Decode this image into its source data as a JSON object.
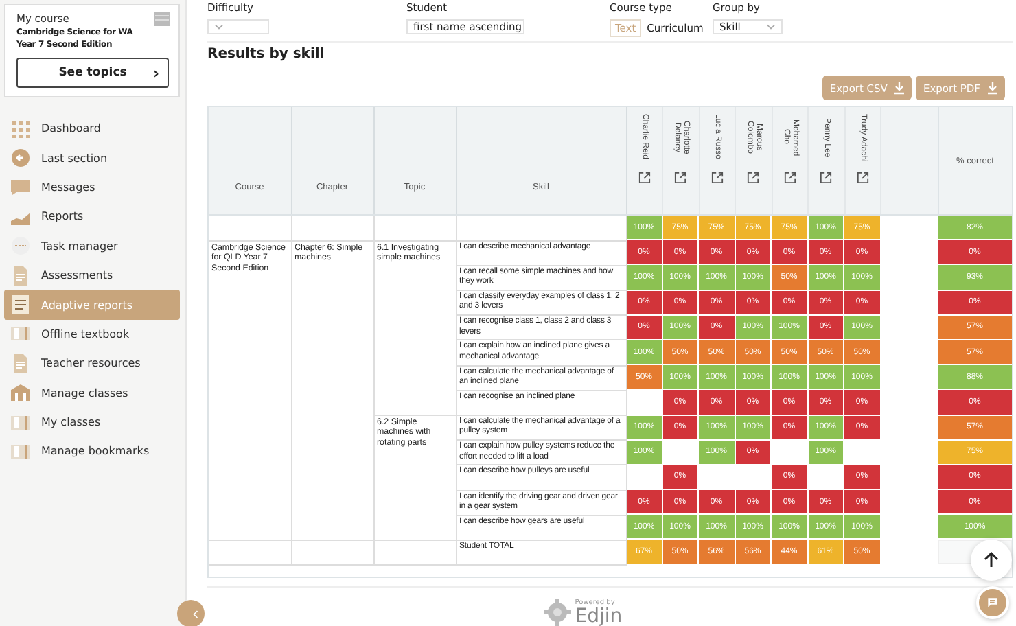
{
  "sidebar": {
    "course_card": {
      "label": "My course",
      "title": "Cambridge Science for WA Year 7 Second Edition",
      "button": "See topics",
      "button_icon": "›"
    },
    "items": [
      {
        "label": "Dashboard",
        "kind": "grid",
        "selected": false
      },
      {
        "label": "Last section",
        "kind": "back",
        "selected": false
      },
      {
        "label": "Messages",
        "kind": "message",
        "selected": false
      },
      {
        "label": "Reports",
        "kind": "chart",
        "selected": false
      },
      {
        "label": "Task manager",
        "kind": "task",
        "selected": false
      },
      {
        "label": "Assessments",
        "kind": "doc",
        "selected": false
      },
      {
        "label": "Adaptive reports",
        "kind": "adaptive",
        "selected": true
      },
      {
        "label": "Offline textbook",
        "kind": "book",
        "selected": false
      },
      {
        "label": "Teacher resources",
        "kind": "doc",
        "selected": false
      },
      {
        "label": "Manage classes",
        "kind": "school",
        "selected": false
      },
      {
        "label": "My classes",
        "kind": "book",
        "selected": false
      },
      {
        "label": "Manage bookmarks",
        "kind": "book",
        "selected": false
      }
    ]
  },
  "filters": {
    "difficulty": {
      "label": "Difficulty"
    },
    "student": {
      "label": "Student",
      "value": "first name ascending"
    },
    "course_type": {
      "label": "Course type",
      "options": [
        {
          "label": "Text",
          "selected": true
        },
        {
          "label": "Curriculum",
          "selected": false
        }
      ]
    },
    "group_by": {
      "label": "Group by",
      "value": "Skill"
    }
  },
  "heading": "Results by skill",
  "buttons": [
    "Export CSV",
    "Export PDF"
  ],
  "table": {
    "columns": [
      "Course",
      "Chapter",
      "Topic",
      "Skill"
    ],
    "percent_column": "% correct",
    "students": [
      "Charlie Reid",
      "Charlotte Delaney",
      "Lucia Russo",
      "Marcus Colombo",
      "Mohamed Cho",
      "Penny Lee",
      "Trudy Adachi"
    ],
    "summary_row": {
      "cells": [
        {
          "value": "100%",
          "color": "#8cc152"
        },
        {
          "value": "75%",
          "color": "#eeb32b"
        },
        {
          "value": "75%",
          "color": "#eeb32b"
        },
        {
          "value": "75%",
          "color": "#eeb32b"
        },
        {
          "value": "75%",
          "color": "#eeb32b"
        },
        {
          "value": "100%",
          "color": "#8cc152"
        },
        {
          "value": "75%",
          "color": "#eeb32b"
        }
      ],
      "percent": {
        "value": "82%",
        "color": "#8cc152"
      }
    },
    "course": {
      "name": "Cambridge Science for QLD Year 7 Second Edition",
      "chapters": [
        {
          "name": "Chapter 6: Simple machines",
          "topics": [
            {
              "name": "6.1 Investigating simple machines",
              "skills": [
                {
                  "skill": "I can describe mechanical advantage",
                  "cells": [
                    {
                      "value": "0%",
                      "color": "#d2343a"
                    },
                    {
                      "value": "0%",
                      "color": "#d2343a"
                    },
                    {
                      "value": "0%",
                      "color": "#d2343a"
                    },
                    {
                      "value": "0%",
                      "color": "#d2343a"
                    },
                    {
                      "value": "0%",
                      "color": "#d2343a"
                    },
                    {
                      "value": "0%",
                      "color": "#d2343a"
                    },
                    {
                      "value": "0%",
                      "color": "#d2343a"
                    }
                  ],
                  "percent": {
                    "value": "0%",
                    "color": "#d2343a"
                  }
                },
                {
                  "skill": "I can recall some simple machines and how they work",
                  "cells": [
                    {
                      "value": "100%",
                      "color": "#8cc152"
                    },
                    {
                      "value": "100%",
                      "color": "#8cc152"
                    },
                    {
                      "value": "100%",
                      "color": "#8cc152"
                    },
                    {
                      "value": "100%",
                      "color": "#8cc152"
                    },
                    {
                      "value": "50%",
                      "color": "#e57b30"
                    },
                    {
                      "value": "100%",
                      "color": "#8cc152"
                    },
                    {
                      "value": "100%",
                      "color": "#8cc152"
                    }
                  ],
                  "percent": {
                    "value": "93%",
                    "color": "#8cc152"
                  }
                },
                {
                  "skill": "I can classify everyday examples of class 1, 2 and 3 levers",
                  "cells": [
                    {
                      "value": "0%",
                      "color": "#d2343a"
                    },
                    {
                      "value": "0%",
                      "color": "#d2343a"
                    },
                    {
                      "value": "0%",
                      "color": "#d2343a"
                    },
                    {
                      "value": "0%",
                      "color": "#d2343a"
                    },
                    {
                      "value": "0%",
                      "color": "#d2343a"
                    },
                    {
                      "value": "0%",
                      "color": "#d2343a"
                    },
                    {
                      "value": "0%",
                      "color": "#d2343a"
                    }
                  ],
                  "percent": {
                    "value": "0%",
                    "color": "#d2343a"
                  }
                },
                {
                  "skill": "I can recognise class 1, class 2 and class 3 levers",
                  "cells": [
                    {
                      "value": "0%",
                      "color": "#d2343a"
                    },
                    {
                      "value": "100%",
                      "color": "#8cc152"
                    },
                    {
                      "value": "0%",
                      "color": "#d2343a"
                    },
                    {
                      "value": "100%",
                      "color": "#8cc152"
                    },
                    {
                      "value": "100%",
                      "color": "#8cc152"
                    },
                    {
                      "value": "0%",
                      "color": "#d2343a"
                    },
                    {
                      "value": "100%",
                      "color": "#8cc152"
                    }
                  ],
                  "percent": {
                    "value": "57%",
                    "color": "#e57b30"
                  }
                },
                {
                  "skill": "I can explain how an inclined plane gives a mechanical advantage",
                  "cells": [
                    {
                      "value": "100%",
                      "color": "#8cc152"
                    },
                    {
                      "value": "50%",
                      "color": "#e57b30"
                    },
                    {
                      "value": "50%",
                      "color": "#e57b30"
                    },
                    {
                      "value": "50%",
                      "color": "#e57b30"
                    },
                    {
                      "value": "50%",
                      "color": "#e57b30"
                    },
                    {
                      "value": "50%",
                      "color": "#e57b30"
                    },
                    {
                      "value": "50%",
                      "color": "#e57b30"
                    }
                  ],
                  "percent": {
                    "value": "57%",
                    "color": "#e57b30"
                  }
                },
                {
                  "skill": "I can calculate the mechanical advantage of an inclined plane",
                  "cells": [
                    {
                      "value": "50%",
                      "color": "#e57b30"
                    },
                    {
                      "value": "100%",
                      "color": "#8cc152"
                    },
                    {
                      "value": "100%",
                      "color": "#8cc152"
                    },
                    {
                      "value": "100%",
                      "color": "#8cc152"
                    },
                    {
                      "value": "100%",
                      "color": "#8cc152"
                    },
                    {
                      "value": "100%",
                      "color": "#8cc152"
                    },
                    {
                      "value": "100%",
                      "color": "#8cc152"
                    }
                  ],
                  "percent": {
                    "value": "88%",
                    "color": "#8cc152"
                  }
                },
                {
                  "skill": "I can recognise an inclined plane",
                  "cells": [
                    null,
                    {
                      "value": "0%",
                      "color": "#d2343a"
                    },
                    {
                      "value": "0%",
                      "color": "#d2343a"
                    },
                    {
                      "value": "0%",
                      "color": "#d2343a"
                    },
                    {
                      "value": "0%",
                      "color": "#d2343a"
                    },
                    {
                      "value": "0%",
                      "color": "#d2343a"
                    },
                    {
                      "value": "0%",
                      "color": "#d2343a"
                    }
                  ],
                  "percent": {
                    "value": "0%",
                    "color": "#d2343a"
                  }
                }
              ]
            },
            {
              "name": "6.2 Simple machines with rotating parts",
              "skills": [
                {
                  "skill": "I can calculate the mechanical advantage of a pulley system",
                  "cells": [
                    {
                      "value": "100%",
                      "color": "#8cc152"
                    },
                    {
                      "value": "0%",
                      "color": "#d2343a"
                    },
                    {
                      "value": "100%",
                      "color": "#8cc152"
                    },
                    {
                      "value": "100%",
                      "color": "#8cc152"
                    },
                    {
                      "value": "0%",
                      "color": "#d2343a"
                    },
                    {
                      "value": "100%",
                      "color": "#8cc152"
                    },
                    {
                      "value": "0%",
                      "color": "#d2343a"
                    }
                  ],
                  "percent": {
                    "value": "57%",
                    "color": "#e57b30"
                  }
                },
                {
                  "skill": "I can explain how pulley systems reduce the effort needed to lift a load",
                  "cells": [
                    {
                      "value": "100%",
                      "color": "#8cc152"
                    },
                    null,
                    {
                      "value": "100%",
                      "color": "#8cc152"
                    },
                    {
                      "value": "0%",
                      "color": "#d2343a"
                    },
                    null,
                    {
                      "value": "100%",
                      "color": "#8cc152"
                    },
                    null
                  ],
                  "percent": {
                    "value": "75%",
                    "color": "#eeb32b"
                  }
                },
                {
                  "skill": "I can describe how pulleys are useful",
                  "cells": [
                    null,
                    {
                      "value": "0%",
                      "color": "#d2343a"
                    },
                    null,
                    null,
                    {
                      "value": "0%",
                      "color": "#d2343a"
                    },
                    null,
                    {
                      "value": "0%",
                      "color": "#d2343a"
                    }
                  ],
                  "percent": {
                    "value": "0%",
                    "color": "#d2343a"
                  }
                },
                {
                  "skill": "I can identify the driving gear and driven gear in a gear system",
                  "cells": [
                    {
                      "value": "0%",
                      "color": "#d2343a"
                    },
                    {
                      "value": "0%",
                      "color": "#d2343a"
                    },
                    {
                      "value": "0%",
                      "color": "#d2343a"
                    },
                    {
                      "value": "0%",
                      "color": "#d2343a"
                    },
                    {
                      "value": "0%",
                      "color": "#d2343a"
                    },
                    {
                      "value": "0%",
                      "color": "#d2343a"
                    },
                    {
                      "value": "0%",
                      "color": "#d2343a"
                    }
                  ],
                  "percent": {
                    "value": "0%",
                    "color": "#d2343a"
                  }
                },
                {
                  "skill": "I can describe how gears are useful",
                  "cells": [
                    {
                      "value": "100%",
                      "color": "#8cc152"
                    },
                    {
                      "value": "100%",
                      "color": "#8cc152"
                    },
                    {
                      "value": "100%",
                      "color": "#8cc152"
                    },
                    {
                      "value": "100%",
                      "color": "#8cc152"
                    },
                    {
                      "value": "100%",
                      "color": "#8cc152"
                    },
                    {
                      "value": "100%",
                      "color": "#8cc152"
                    },
                    {
                      "value": "100%",
                      "color": "#8cc152"
                    }
                  ],
                  "percent": {
                    "value": "100%",
                    "color": "#8cc152"
                  }
                }
              ]
            }
          ]
        }
      ]
    },
    "total_row": {
      "label": "Student TOTAL",
      "cells": [
        {
          "value": "67%",
          "color": "#eeb32b"
        },
        {
          "value": "50%",
          "color": "#e57b30"
        },
        {
          "value": "56%",
          "color": "#e57b30"
        },
        {
          "value": "56%",
          "color": "#e57b30"
        },
        {
          "value": "44%",
          "color": "#e57b30"
        },
        {
          "value": "61%",
          "color": "#eeb32b"
        },
        {
          "value": "50%",
          "color": "#e57b30"
        }
      ]
    }
  },
  "footer": {
    "powered_by": "Powered by",
    "brand": "Edjin"
  }
}
